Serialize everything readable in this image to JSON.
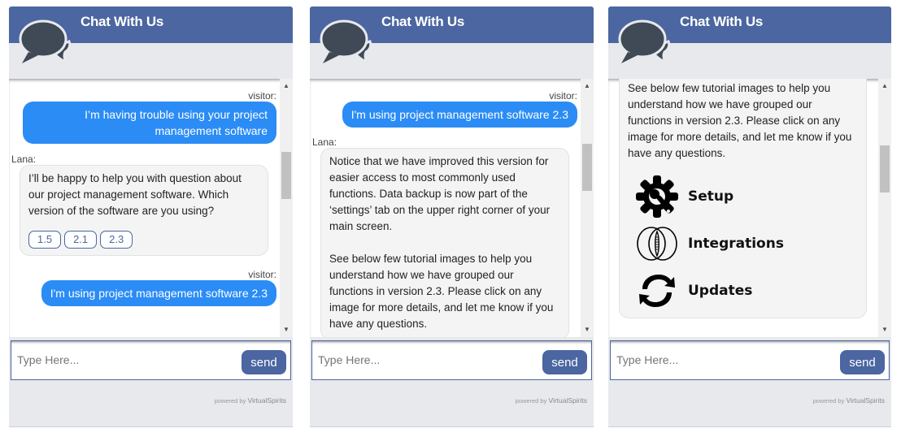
{
  "header": {
    "title": "Chat With Us",
    "logo_icon": "chat-bubbles-icon"
  },
  "colors": {
    "brand": "#4b66a0",
    "visitor_bubble": "#2b8cf5",
    "agent_bubble": "#f4f4f4",
    "panel_bg": "#e8e9ed"
  },
  "input": {
    "placeholder": "Type Here...",
    "send_label": "send"
  },
  "footer": {
    "powered": "powered  by",
    "brand": "VirtualSpirits"
  },
  "panels": [
    {
      "messages": [
        {
          "sender": "visitor:",
          "text": "I’m having trouble using your project management software"
        },
        {
          "sender": "Lana:",
          "text": "I’ll be happy to help you with question about our project management software. Which version of the software are you using?",
          "options": [
            "1.5",
            "2.1",
            "2.3"
          ]
        },
        {
          "sender": "visitor:",
          "text": "I'm using project management software 2.3"
        }
      ]
    },
    {
      "messages": [
        {
          "sender": "visitor:",
          "text": "I'm using project management software 2.3"
        },
        {
          "sender": "Lana:",
          "text": "Notice that we have improved this version for easier access to most commonly used functions. Data backup is now part of the ‘settings’ tab on the upper right corner of your main screen.",
          "text2": "See below few tutorial images to help you understand how we have grouped our functions in version 2.3. Please click on any image for more details, and let me know if you have any questions."
        }
      ]
    },
    {
      "messages": [
        {
          "text": "See below few tutorial images to help you understand how we have grouped our functions in version 2.3. Please click on any image for more details, and let me know if you have any questions.",
          "features": [
            {
              "label": "Setup",
              "icon": "gear-wrench-icon"
            },
            {
              "label": "Integrations",
              "icon": "integration-circles-icon"
            },
            {
              "label": "Updates",
              "icon": "refresh-arrows-icon"
            }
          ]
        }
      ]
    }
  ]
}
